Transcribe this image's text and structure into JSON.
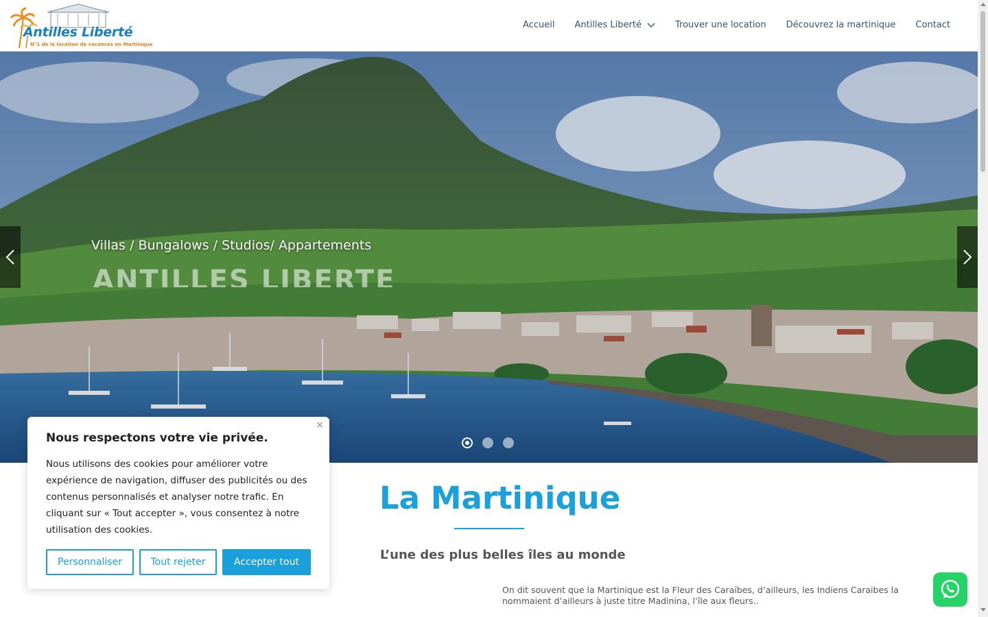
{
  "header": {
    "logo_text": "Antilles Liberté",
    "logo_tagline": "N°1 de la location de vacances en Martinique",
    "nav": [
      {
        "label": "Accueil"
      },
      {
        "label": "Antilles Liberté"
      },
      {
        "label": "Trouver une location"
      },
      {
        "label": "Découvrez la martinique"
      },
      {
        "label": "Contact"
      }
    ]
  },
  "hero": {
    "subtitle": "Villas / Bungalows / Studios/ Appartements",
    "title": "ANTILLES LIBERTE",
    "slides_total": 3,
    "active_slide": 1
  },
  "section": {
    "title": "La Martinique",
    "subtitle": "L’une des plus belles îles au monde",
    "body": "On dit souvent que la Martinique est la Fleur des Caraïbes, d’ailleurs, les Indiens Caraibes la nommaient d’ailleurs à juste titre Madinina, l’île aux fleurs.."
  },
  "cookie": {
    "title": "Nous respectons votre vie privée.",
    "text": "Nous utilisons des cookies pour améliorer votre expérience de navigation, diffuser des publicités ou des contenus personnalisés et analyser notre trafic. En cliquant sur « Tout accepter », vous consentez à notre utilisation des cookies.",
    "close_icon": "×",
    "btn_customize": "Personnaliser",
    "btn_reject": "Tout rejeter",
    "btn_accept": "Accepter tout"
  },
  "colors": {
    "accent": "#1aa0db",
    "nav_text": "#35536f",
    "whatsapp": "#25d366"
  }
}
